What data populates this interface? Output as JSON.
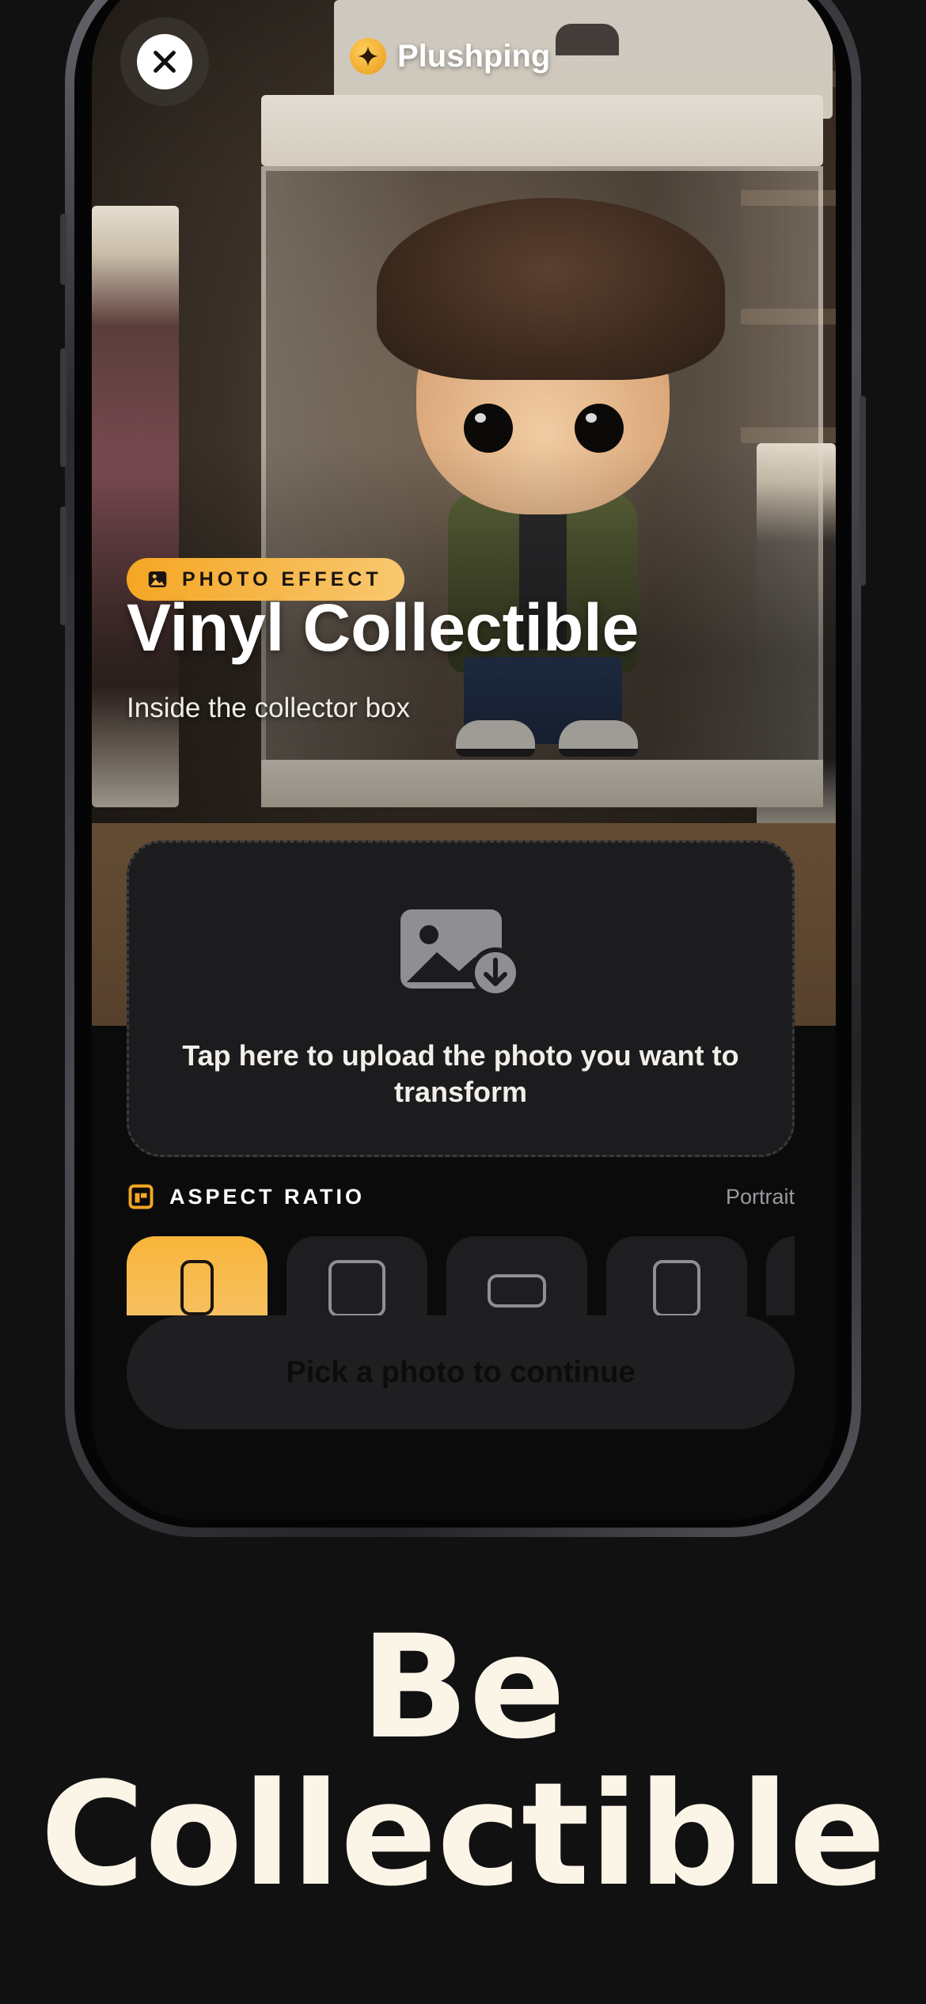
{
  "header": {
    "brand_name": "Plushping",
    "close_icon": "close-icon",
    "brand_icon": "sparkle-icon"
  },
  "effect": {
    "badge": "PHOTO EFFECT",
    "badge_icon": "image-icon",
    "title": "Vinyl Collectible",
    "subtitle": "Inside the collector box"
  },
  "upload": {
    "icon": "image-download-icon",
    "text": "Tap here to upload the photo you want to transform"
  },
  "aspect_ratio": {
    "label": "ASPECT RATIO",
    "icon": "aspect-ratio-icon",
    "selected": "Portrait",
    "options": [
      "portrait",
      "square",
      "landscape",
      "portrait-alt",
      "more"
    ]
  },
  "continue_button": {
    "label": "Pick a photo to continue"
  },
  "tagline": {
    "line1": "Be",
    "line2": "Collectible"
  },
  "colors": {
    "accent": "#F5A623",
    "background": "#111112",
    "card": "#1C1C1E"
  }
}
